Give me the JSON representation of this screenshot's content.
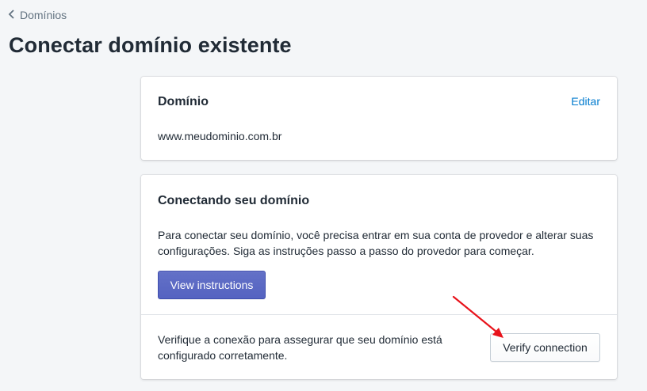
{
  "breadcrumb": {
    "icon": "chevron-left-icon",
    "label": "Domínios"
  },
  "page": {
    "title": "Conectar domínio existente"
  },
  "domain_card": {
    "heading": "Domínio",
    "edit_label": "Editar",
    "domain": "www.meudominio.com.br"
  },
  "connect_card": {
    "heading": "Conectando seu domínio",
    "description": "Para conectar seu domínio, você precisa entrar em sua conta de provedor e alterar suas configurações. Siga as instruções passo a passo do provedor para começar.",
    "view_instructions_label": "View instructions",
    "verify_description": "Verifique a conexão para assegurar que seu domínio está configurado corretamente.",
    "verify_label": "Verify connection"
  },
  "colors": {
    "background": "#f4f6f8",
    "link": "#007ace",
    "primary_button": "#5c6ac4",
    "annotation_arrow": "#e8131b"
  }
}
